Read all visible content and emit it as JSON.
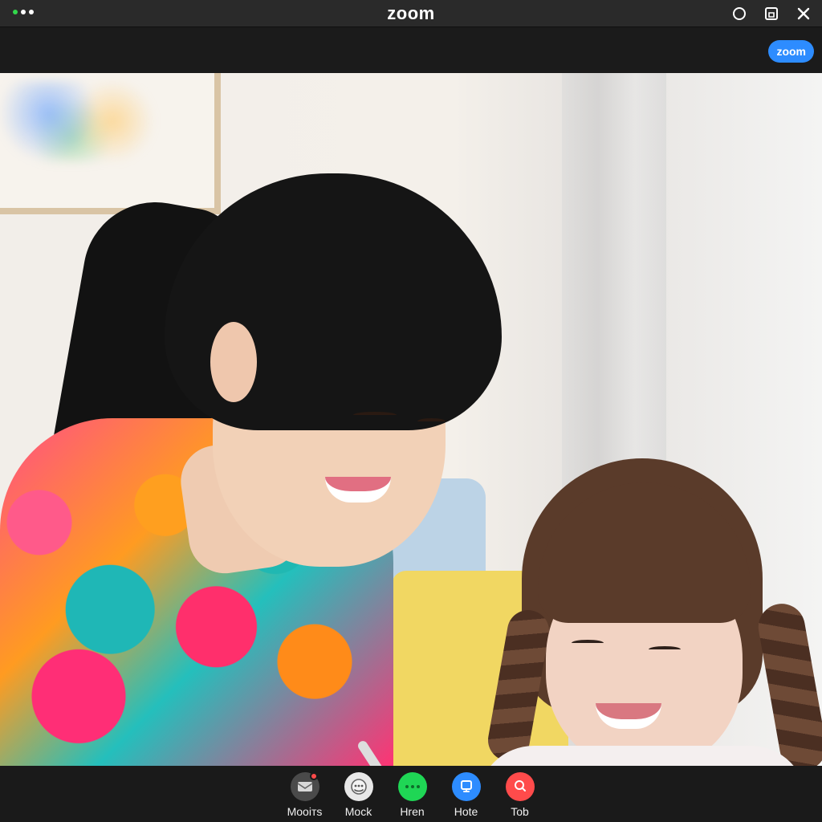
{
  "window": {
    "title": "zoom",
    "traffic_dots": [
      "#32d74b",
      "#ffffff",
      "#ffffff"
    ]
  },
  "header": {
    "brand_badge": "zoom"
  },
  "icons": {
    "circle": "circle-icon",
    "screen": "screen-icon",
    "close": "close-icon"
  },
  "controls": [
    {
      "label": "Mooітs",
      "icon": "mail-icon",
      "color": "#4a4a4a",
      "notification": true
    },
    {
      "label": "Mock",
      "icon": "chat-icon",
      "color": "#e8e8e8",
      "notification": false
    },
    {
      "label": "Hren",
      "icon": "more-icon",
      "color": "#1fd655",
      "notification": false
    },
    {
      "label": "Hote",
      "icon": "share-icon",
      "color": "#2d8cff",
      "notification": false
    },
    {
      "label": "Tob",
      "icon": "search-icon",
      "color": "#ff4b4b",
      "notification": false
    }
  ]
}
